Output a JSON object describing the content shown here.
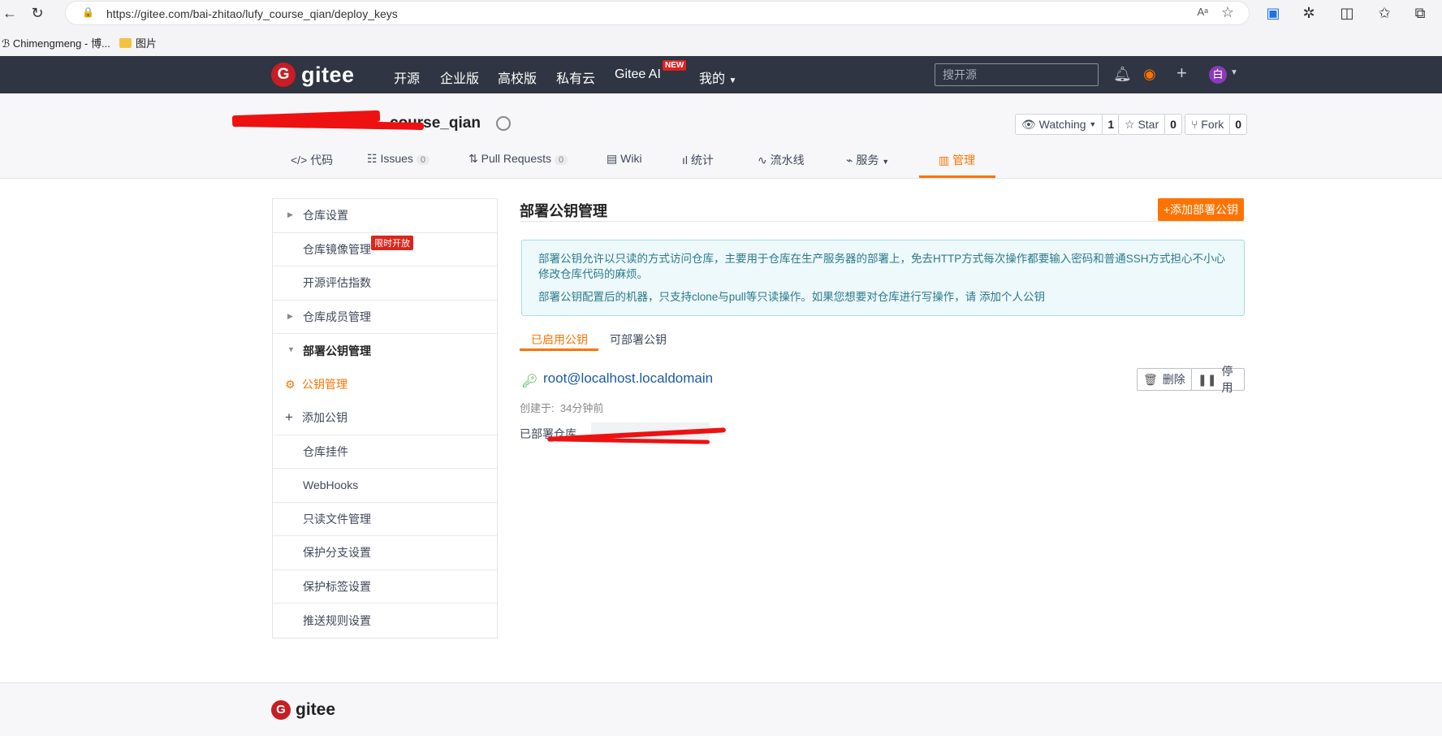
{
  "browser": {
    "url": "https://gitee.com/bai-zhitao/lufy_course_qian/deploy_keys",
    "bookmarks": [
      "Chimengmeng - 博...",
      "图片"
    ]
  },
  "topnav": {
    "logo_text": "gitee",
    "items": [
      "开源",
      "企业版",
      "高校版",
      "私有云",
      "Gitee AI",
      "我的"
    ],
    "new_badge": "NEW",
    "search_placeholder": "搜开源",
    "avatar_text": "白"
  },
  "repo": {
    "title_suffix": "course_qian",
    "watching_label": "Watching",
    "watching_count": "1",
    "star_label": "Star",
    "star_count": "0",
    "fork_label": "Fork",
    "fork_count": "0",
    "tabs": [
      {
        "label": "代码"
      },
      {
        "label": "Issues",
        "badge": "0"
      },
      {
        "label": "Pull Requests",
        "badge": "0"
      },
      {
        "label": "Wiki"
      },
      {
        "label": "统计"
      },
      {
        "label": "流水线"
      },
      {
        "label": "服务"
      },
      {
        "label": "管理"
      }
    ]
  },
  "sidebar": {
    "items": [
      "仓库设置",
      "仓库镜像管理",
      "开源评估指数",
      "仓库成员管理",
      "部署公钥管理",
      "公钥管理",
      "添加公钥",
      "仓库挂件",
      "WebHooks",
      "只读文件管理",
      "保护分支设置",
      "保护标签设置",
      "推送规则设置"
    ],
    "limit_badge": "限时开放"
  },
  "main": {
    "title": "部署公钥管理",
    "add_button": "+添加部署公钥",
    "info_line1": "部署公钥允许以只读的方式访问仓库，主要用于仓库在生产服务器的部署上，免去HTTP方式每次操作都要输入密码和普通SSH方式担心不小心修改仓库代码的麻烦。",
    "info_line2": "部署公钥配置后的机器，只支持clone与pull等只读操作。如果您想要对仓库进行写操作，请",
    "info_link": "添加个人公钥",
    "subtabs": [
      "已启用公钥",
      "可部署公钥"
    ],
    "key_name": "root@localhost.localdomain",
    "delete_label": "删除",
    "disable_label": "停用",
    "created_label": "创建于:",
    "created_value": "34分钟前",
    "deployed_label": "已部署仓库"
  },
  "footer": {
    "logo_text": "gitee"
  },
  "colors": {
    "accent": "#fe7300",
    "nav_bg": "#2f3542",
    "brand_red": "#c71d23"
  }
}
